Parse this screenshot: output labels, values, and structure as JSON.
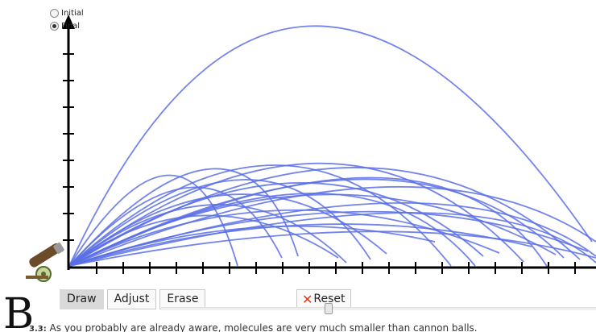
{
  "radio": {
    "options": [
      {
        "label": "Initial",
        "checked": false
      },
      {
        "label": "Final",
        "checked": true
      }
    ]
  },
  "toolbar": {
    "draw_label": "Draw",
    "adjust_label": "Adjust",
    "erase_label": "Erase",
    "active_tool": "Draw",
    "reset_label": "Reset",
    "reset_icon": "close-x-icon"
  },
  "slider": {
    "value_fraction": 0.38
  },
  "caption": {
    "drop_cap": "B",
    "number": "3.3:",
    "text": "As you probably are already aware, molecules are very much smaller than cannon balls."
  },
  "colors": {
    "trajectory": "#5a6fe6",
    "axis": "#000000",
    "reset_x": "#e23a1f",
    "active_tab": "#d9d9d9"
  },
  "icons": [
    "cannon-icon",
    "radio-icon",
    "close-x-icon"
  ]
}
